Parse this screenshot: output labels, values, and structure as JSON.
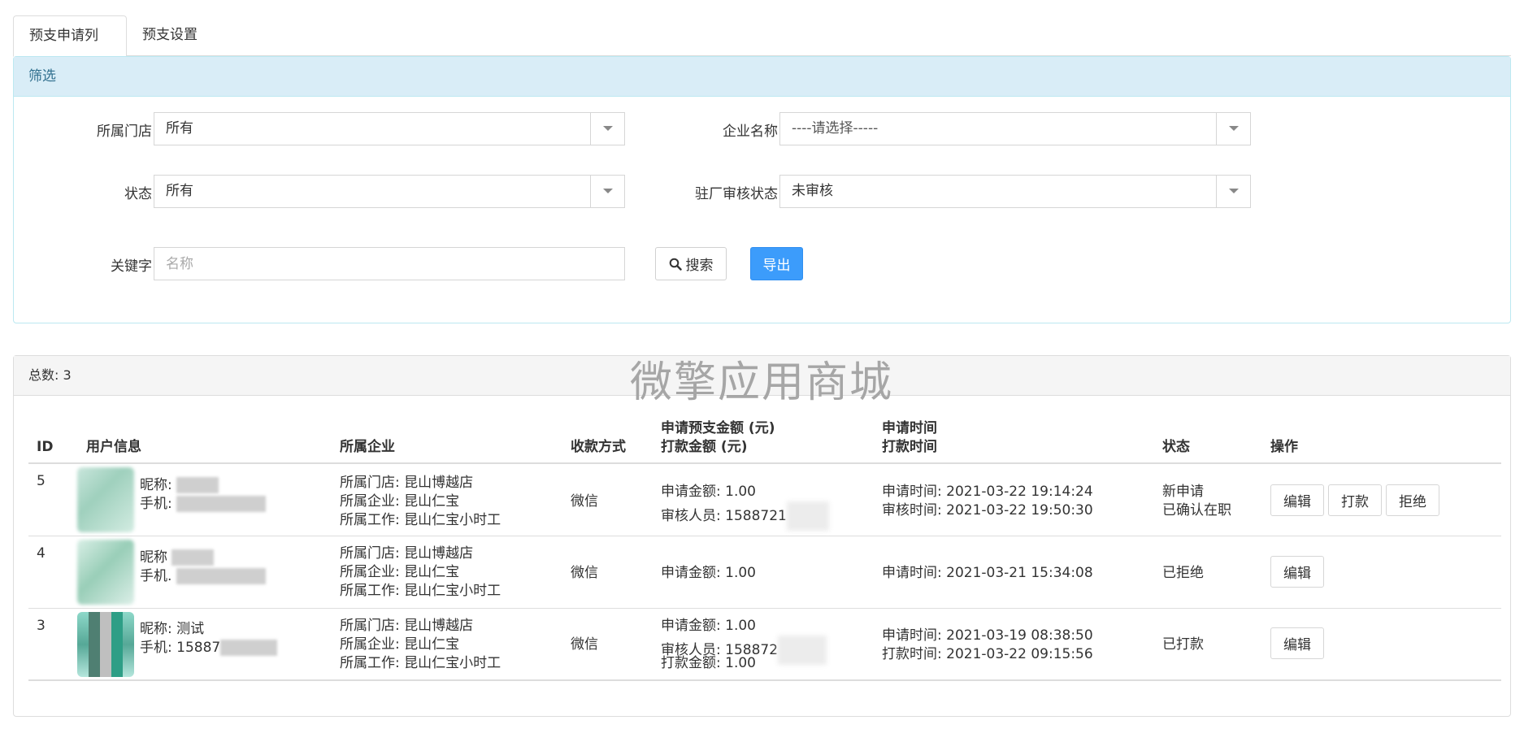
{
  "tabs": [
    {
      "label": "预支申请列表",
      "active": true
    },
    {
      "label": "预支设置",
      "active": false
    }
  ],
  "filter": {
    "heading": "筛选",
    "store_label": "所属门店",
    "store_value": "所有",
    "company_label": "企业名称",
    "company_value": "----请选择-----",
    "status_label": "状态",
    "status_value": "所有",
    "audit_label": "驻厂审核状态",
    "audit_value": "未审核",
    "keyword_label": "关键字",
    "keyword_placeholder": "名称",
    "keyword_value": "",
    "search_label": "搜索",
    "export_label": "导出"
  },
  "list": {
    "total_text": "总数: 3",
    "watermark": "微擎应用商城",
    "headers": {
      "id": "ID",
      "user": "用户信息",
      "company": "所属企业",
      "pay_method": "收款方式",
      "amount_line1": "申请预支金额 (元)",
      "amount_line2": "打款金额 (元)",
      "time_line1": "申请时间",
      "time_line2": "打款时间",
      "status": "状态",
      "ops": "操作"
    },
    "rows": [
      {
        "id": "5",
        "nickname": "昵称:",
        "phone": "手机:",
        "store": "所属门店: 昆山博越店",
        "company": "所属企业: 昆山仁宝",
        "job": "所属工作: 昆山仁宝小时工",
        "pay_method": "微信",
        "amount_line1": "申请金额: 1.00",
        "amount_line2": "审核人员: 1588721",
        "amount_line3": "",
        "time_line1": "申请时间: 2021-03-22 19:14:24",
        "time_line2": "审核时间: 2021-03-22 19:50:30",
        "status_line1": "新申请",
        "status_line2": "已确认在职",
        "ops": [
          "编辑",
          "打款",
          "拒绝"
        ]
      },
      {
        "id": "4",
        "nickname": "昵称",
        "phone": "手机.",
        "store": "所属门店: 昆山博越店",
        "company": "所属企业: 昆山仁宝",
        "job": "所属工作: 昆山仁宝小时工",
        "pay_method": "微信",
        "amount_line1": "申请金额: 1.00",
        "amount_line2": "",
        "amount_line3": "",
        "time_line1": "申请时间: 2021-03-21 15:34:08",
        "time_line2": "",
        "status_line1": "已拒绝",
        "status_line2": "",
        "ops": [
          "编辑"
        ]
      },
      {
        "id": "3",
        "nickname": "昵称: 测试",
        "phone": "手机: 15887",
        "store": "所属门店: 昆山博越店",
        "company": "所属企业: 昆山仁宝",
        "job": "所属工作: 昆山仁宝小时工",
        "pay_method": "微信",
        "amount_line1": "申请金额: 1.00",
        "amount_line2": "审核人员: 158872",
        "amount_line3": "打款金额: 1.00",
        "time_line1": "申请时间: 2021-03-19 08:38:50",
        "time_line2": "打款时间: 2021-03-22 09:15:56",
        "status_line1": "已打款",
        "status_line2": "",
        "ops": [
          "编辑"
        ]
      }
    ]
  }
}
